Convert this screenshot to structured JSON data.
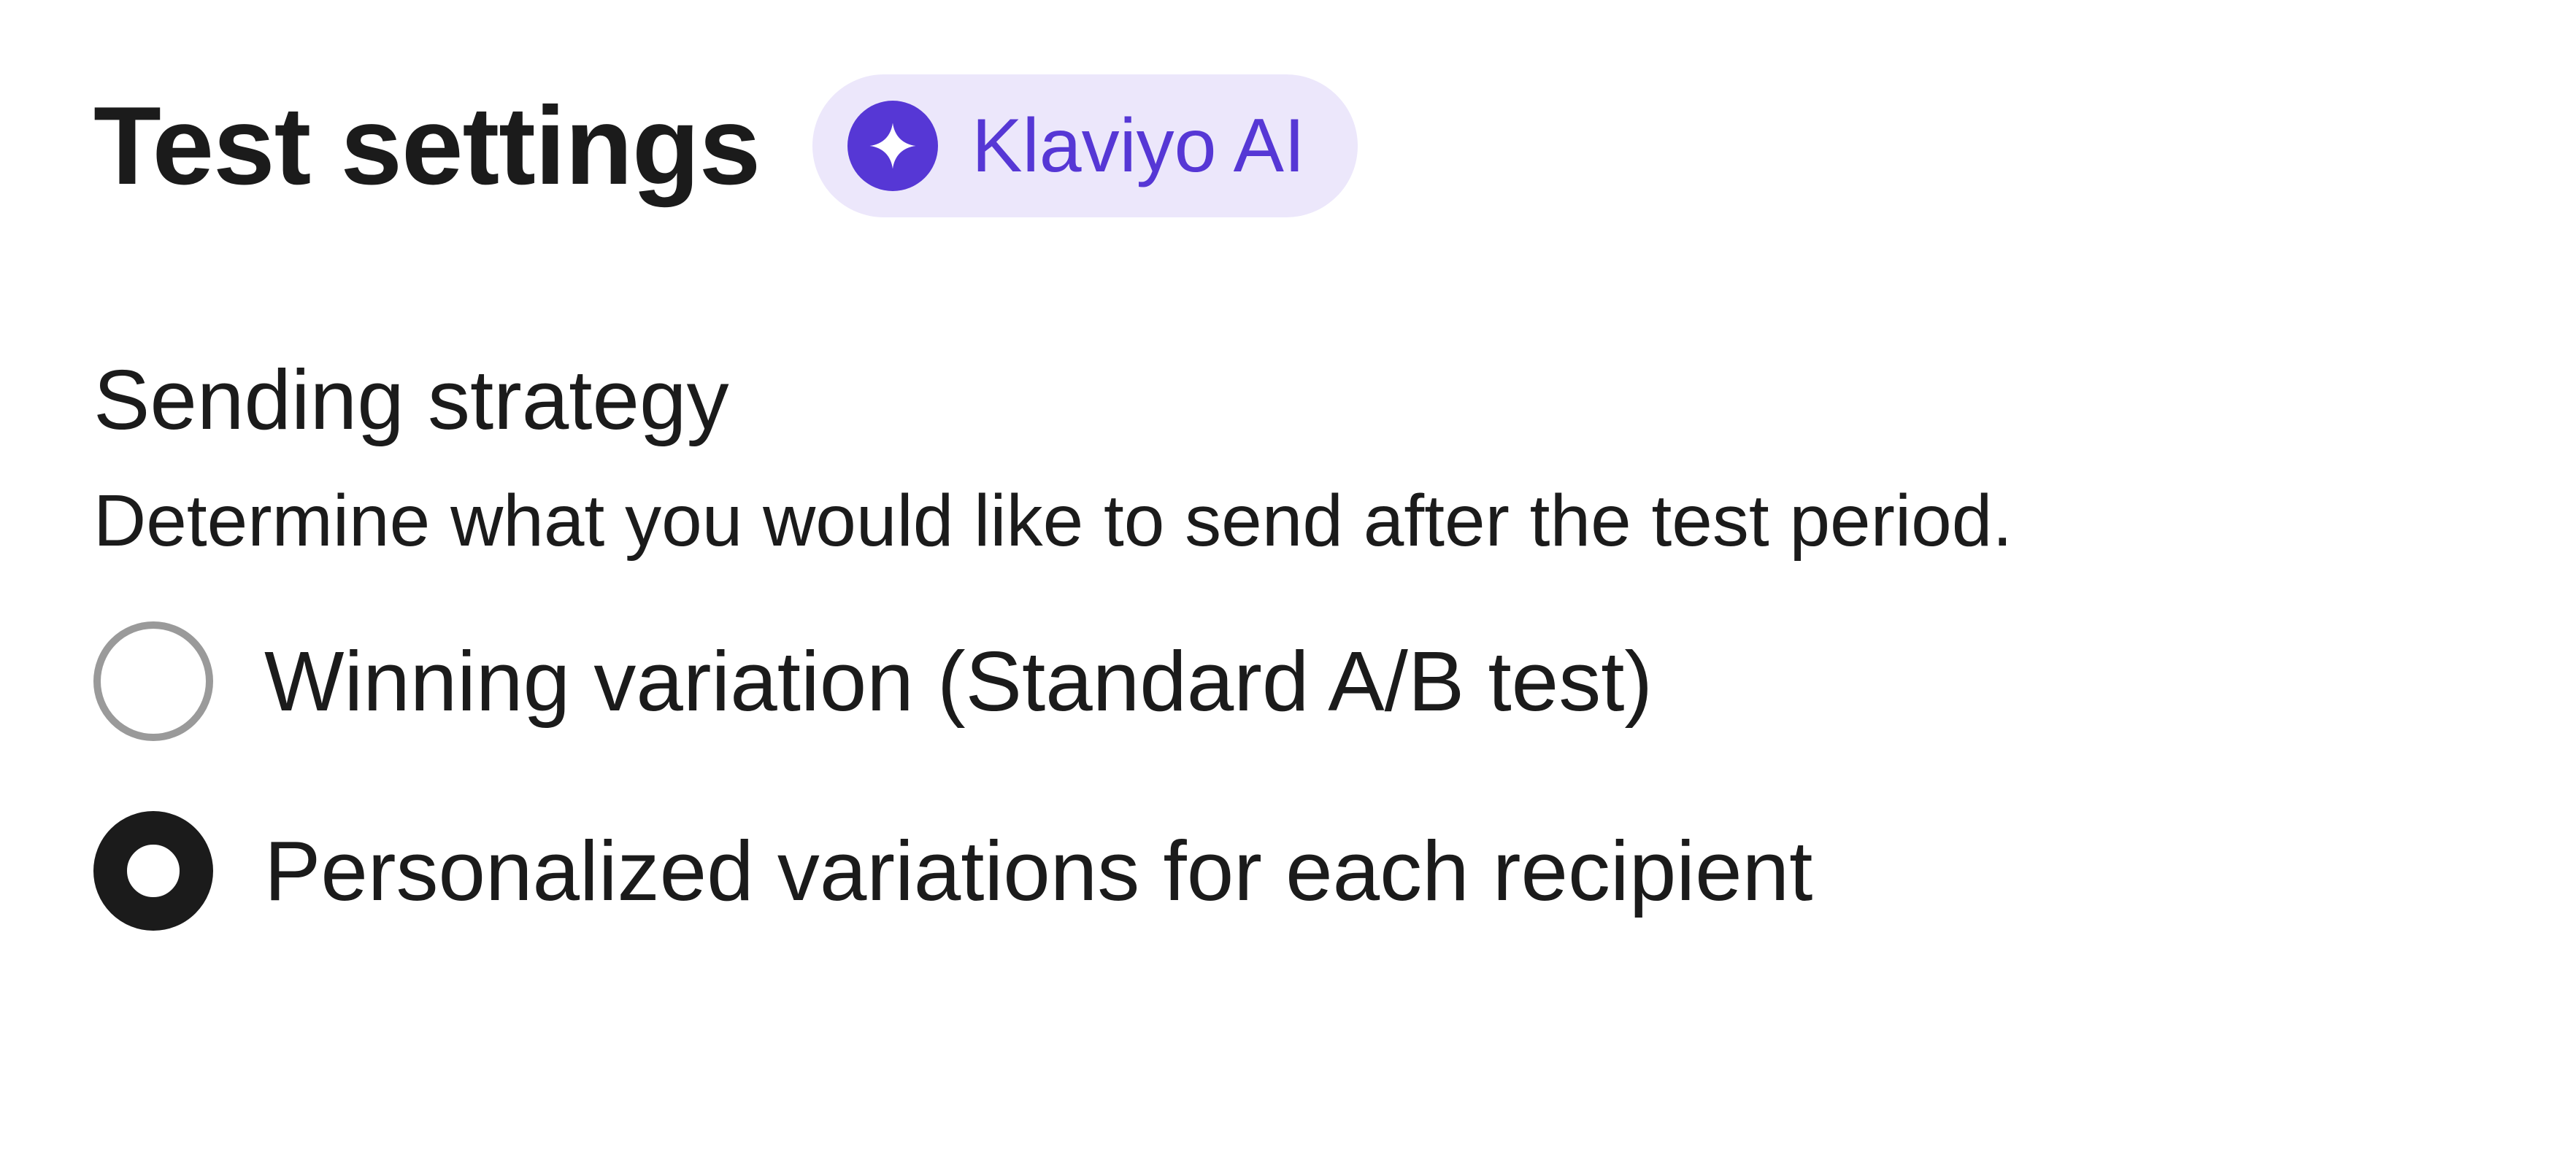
{
  "header": {
    "title": "Test settings",
    "badge": {
      "label": "Klaviyo AI",
      "icon": "sparkle-icon",
      "color": "#5637d5",
      "background": "#ece7fb"
    }
  },
  "sending_strategy": {
    "title": "Sending strategy",
    "description": "Determine what you would like to send after the test period.",
    "options": [
      {
        "label": "Winning variation (Standard A/B test)",
        "selected": false
      },
      {
        "label": "Personalized variations for each recipient",
        "selected": true
      }
    ]
  }
}
